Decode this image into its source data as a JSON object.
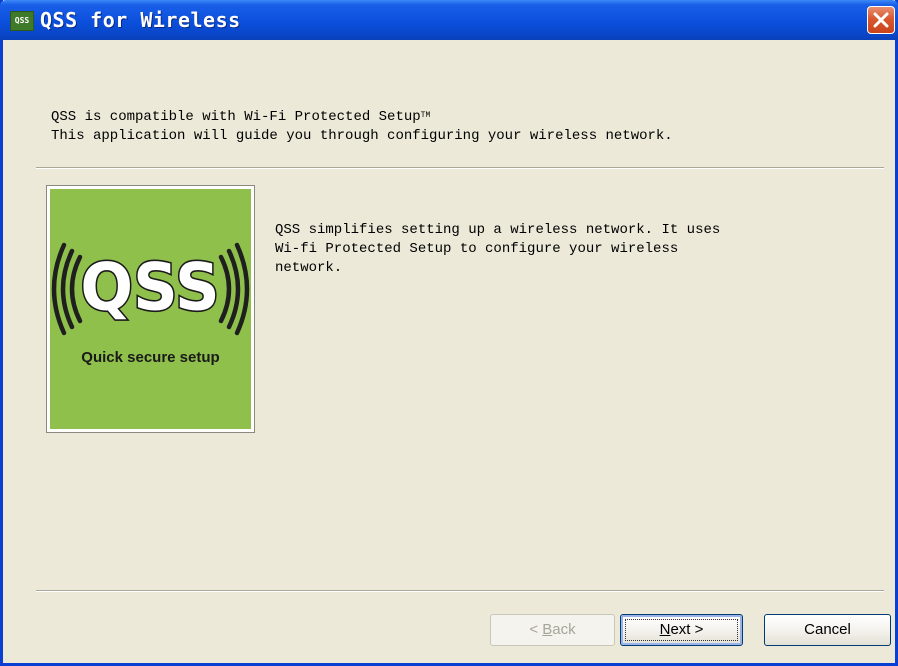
{
  "window": {
    "title": "QSS for Wireless",
    "app_icon_text": "QSS",
    "close_icon": "close-icon"
  },
  "intro": {
    "line1": "QSS is compatible with Wi-Fi Protected Setup",
    "trademark": "TM",
    "line2": "This application will guide you through configuring your wireless network."
  },
  "logo": {
    "text": "QSS",
    "subtitle": "Quick secure setup",
    "background": "#8fc04b"
  },
  "description": "QSS simplifies setting up a wireless network. It uses\nWi-fi Protected Setup to configure your wireless\nnetwork.",
  "buttons": {
    "back": {
      "prefix": "< ",
      "accel": "B",
      "rest": "ack",
      "enabled": false
    },
    "next": {
      "accel": "N",
      "rest": "ext >",
      "default": true
    },
    "cancel": {
      "label": "Cancel"
    }
  },
  "colors": {
    "titlebar": "#0b4fdc",
    "dialog_bg": "#ece9d8",
    "close": "#d9592f"
  }
}
